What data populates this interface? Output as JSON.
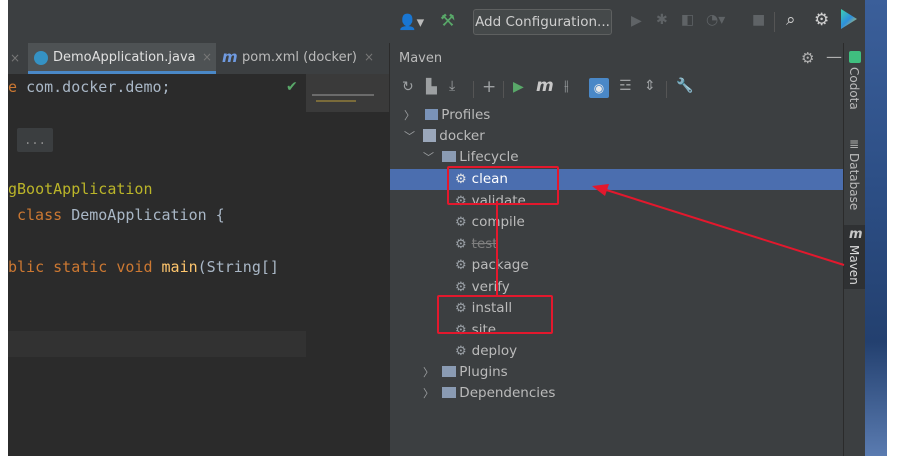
{
  "toolbar": {
    "run_config_label": "Add Configuration...",
    "icons": [
      "user-icon",
      "hammer-icon",
      "run-icon",
      "debug-icon",
      "coverage-icon",
      "profile-icon",
      "stop-icon",
      "search-icon",
      "settings-icon",
      "toolbox-icon"
    ]
  },
  "tabs": [
    {
      "label": "DemoApplication.java"
    },
    {
      "label": "pom.xml (docker)"
    }
  ],
  "editor": {
    "line1_kw": "e ",
    "line1_pkg": "com.docker.demo;",
    "fold_text": "...",
    "annotation": "gBootApplication",
    "class_kw": "class ",
    "class_name": "DemoApplication {",
    "main_kw": "blic static void ",
    "main_fn": "main",
    "main_args": "(String[]"
  },
  "maven": {
    "title": "Maven",
    "toolbar_icons": [
      "reload-icon",
      "generate-sources-icon",
      "download-icon",
      "add-icon",
      "run-icon",
      "execute-goal-icon",
      "toggle-offline-icon",
      "skip-tests-icon",
      "show-dependencies-icon",
      "collapse-all-icon",
      "settings-icon"
    ],
    "tree": {
      "profiles": "Profiles",
      "project": "docker",
      "lifecycle": "Lifecycle",
      "phases": [
        "clean",
        "validate",
        "compile",
        "test",
        "package",
        "verify",
        "install",
        "site",
        "deploy"
      ],
      "selected": "clean",
      "struck": [
        "test"
      ],
      "plugins": "Plugins",
      "dependencies": "Dependencies"
    }
  },
  "side_tabs": {
    "codota": "Codota",
    "database": "Database",
    "maven": "Maven"
  },
  "colors": {
    "highlight": "#e3182d",
    "selection": "#4b6eaf",
    "panel": "#3c3f41",
    "editor": "#2b2b2b"
  }
}
